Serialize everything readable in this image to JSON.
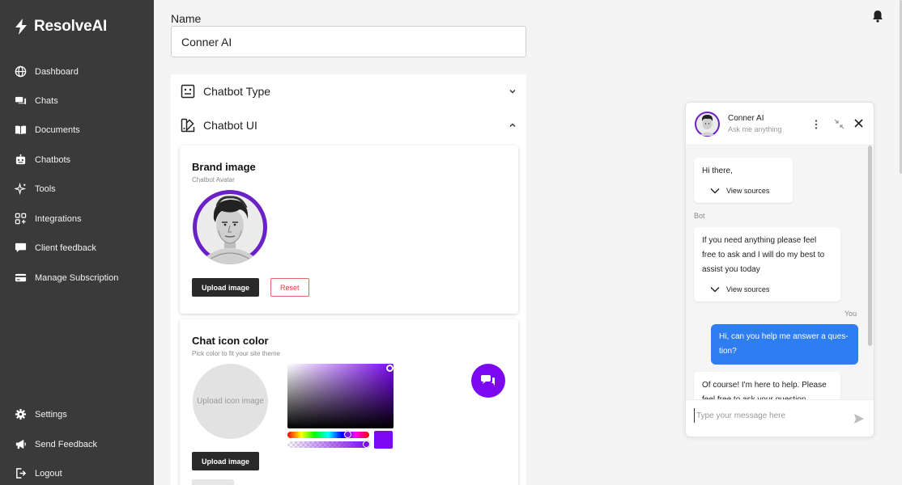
{
  "app": {
    "name": "ResolveAI"
  },
  "sidebar": {
    "items": [
      {
        "label": "Dashboard",
        "icon": "globe-icon"
      },
      {
        "label": "Chats",
        "icon": "chat-icon"
      },
      {
        "label": "Documents",
        "icon": "book-icon"
      },
      {
        "label": "Chatbots",
        "icon": "robot-icon"
      },
      {
        "label": "Tools",
        "icon": "sparkle-icon"
      },
      {
        "label": "Integrations",
        "icon": "grid-plus-icon"
      },
      {
        "label": "Client feedback",
        "icon": "message-icon"
      },
      {
        "label": "Manage Subscription",
        "icon": "card-icon"
      }
    ],
    "bottom": [
      {
        "label": "Settings",
        "icon": "gear-icon"
      },
      {
        "label": "Send Feedback",
        "icon": "megaphone-icon"
      },
      {
        "label": "Logout",
        "icon": "logout-icon"
      }
    ]
  },
  "form": {
    "name_label": "Name",
    "name_value": "Conner AI",
    "chatbot_type_label": "Chatbot Type",
    "chatbot_ui_label": "Chatbot UI",
    "brand": {
      "title": "Brand image",
      "subtitle": "Chatbot Avatar",
      "upload_label": "Upload image",
      "reset_label": "Reset"
    },
    "icon_color": {
      "title": "Chat icon color",
      "subtitle": "Pick color to fit your site theme",
      "upload_placeholder": "Upload icon image",
      "upload_label": "Upload image",
      "selected_color": "#7a08f0"
    }
  },
  "widget": {
    "bot_name": "Conner AI",
    "bot_status": "Ask me anything",
    "messages": [
      {
        "from": "bot",
        "text": "Hi there,",
        "sources_label": "View sources"
      },
      {
        "from_label": "Bot"
      },
      {
        "from": "bot",
        "lines": [
          "If you need anything please feel",
          "free to ask and I will do my best to",
          "assist you today"
        ],
        "sources_label": "View sources"
      },
      {
        "from_label": "You"
      },
      {
        "from": "user",
        "lines": [
          "Hi, can you help me answer a ques-",
          "tion?"
        ]
      },
      {
        "from": "bot",
        "lines": [
          "Of course! I'm here to help. Please",
          "feel free to ask your question"
        ]
      }
    ],
    "input_placeholder": "Type your message here"
  },
  "colors": {
    "sidebar": "#3a3a3a",
    "accent": "#7a08f0",
    "user_bubble": "#2f7df2"
  }
}
